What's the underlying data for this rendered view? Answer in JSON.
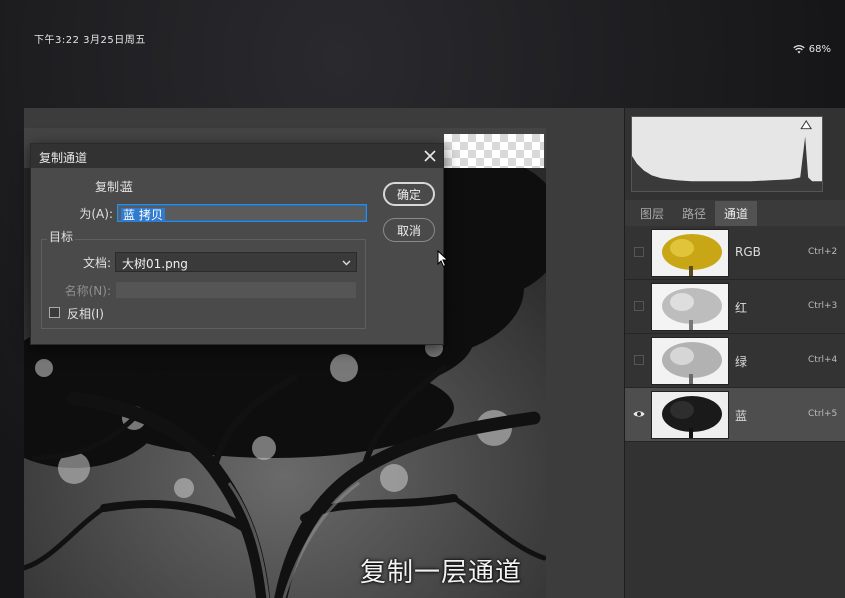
{
  "status_bar": {
    "time": "下午3:22  3月25日周五",
    "battery": "68%"
  },
  "panels": {
    "tabs": [
      {
        "label": "图层",
        "active": false
      },
      {
        "label": "路径",
        "active": false
      },
      {
        "label": "通道",
        "active": true
      }
    ],
    "channels": [
      {
        "name": "RGB",
        "shortcut": "Ctrl+2",
        "visible": false,
        "selected": false,
        "thumb": "color"
      },
      {
        "name": "红",
        "shortcut": "Ctrl+3",
        "visible": false,
        "selected": false,
        "thumb": "light"
      },
      {
        "name": "绿",
        "shortcut": "Ctrl+4",
        "visible": false,
        "selected": false,
        "thumb": "light"
      },
      {
        "name": "蓝",
        "shortcut": "Ctrl+5",
        "visible": true,
        "selected": true,
        "thumb": "dark"
      }
    ]
  },
  "dialog": {
    "title": "复制通道",
    "copy_label": "复制:",
    "copy_value": "蓝",
    "as_label": "为(A):",
    "as_value": "蓝 拷贝",
    "target_group": "目标",
    "document_label": "文档:",
    "document_value": "大树01.png",
    "name_label": "名称(N):",
    "name_value": "",
    "invert_label": "反相(I)",
    "invert_checked": false,
    "ok_label": "确定",
    "cancel_label": "取消"
  },
  "caption": "复制一层通道",
  "colors": {
    "accent": "#2f7bd0",
    "panel": "#323232",
    "dialog": "#4a4a4a"
  }
}
